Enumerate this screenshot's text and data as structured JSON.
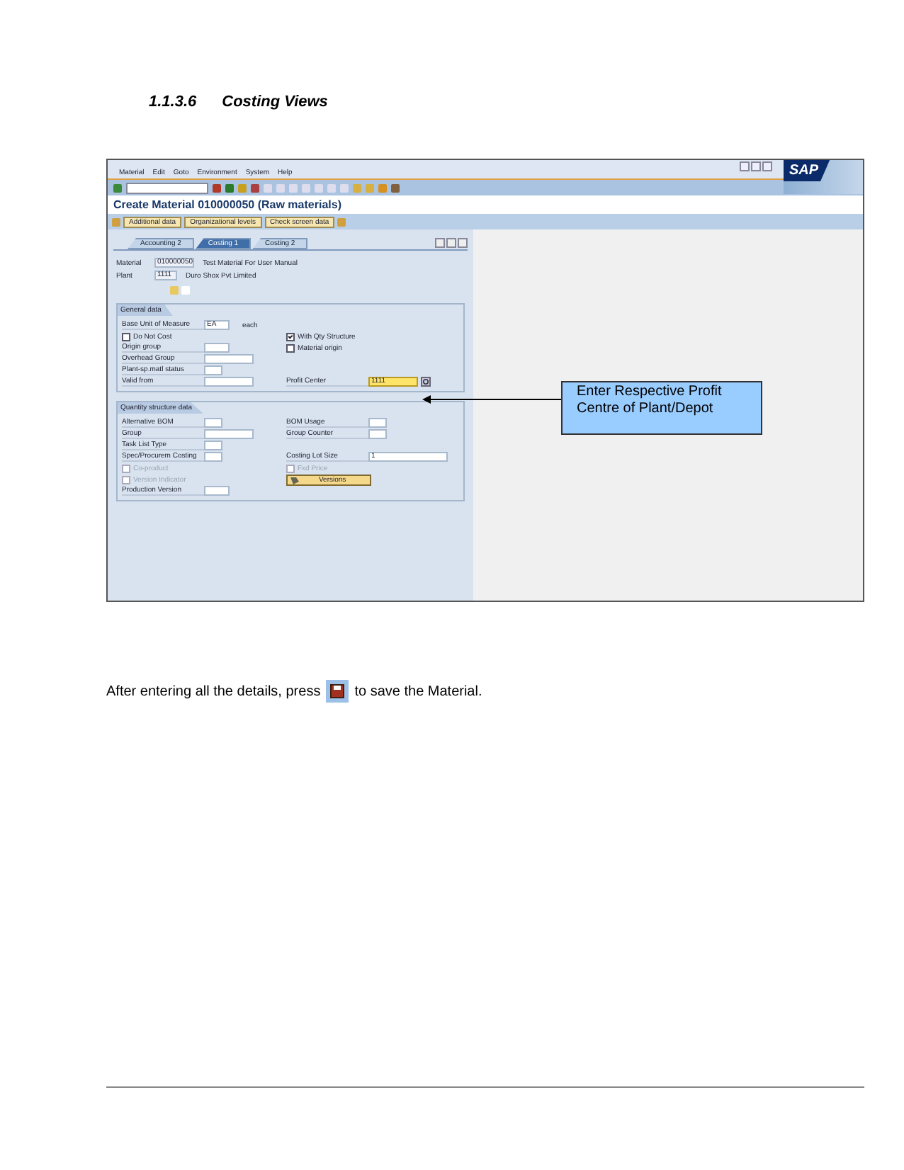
{
  "heading": {
    "number": "1.1.3.6",
    "title": "Costing Views"
  },
  "screen": {
    "menu": [
      "Material",
      "Edit",
      "Goto",
      "Environment",
      "System",
      "Help"
    ],
    "logo": "SAP",
    "title": "Create Material 010000050 (Raw materials)",
    "app_toolbar": [
      "Additional data",
      "Organizational levels",
      "Check screen data"
    ],
    "tabs": [
      {
        "label": "Accounting 2",
        "selected": false
      },
      {
        "label": "Costing 1",
        "selected": true
      },
      {
        "label": "Costing 2",
        "selected": false
      }
    ],
    "header": [
      {
        "label": "Material",
        "value": "010000050",
        "description": "Test Material For User Manual"
      },
      {
        "label": "Plant",
        "value": "1111",
        "description": "Duro Shox Pvt Limited"
      }
    ],
    "groups": [
      {
        "title": "General data",
        "rows": [
          [
            {
              "kind": "field",
              "label": "Base Unit of Measure",
              "value": "EA",
              "suffix": "each"
            }
          ],
          [
            {
              "kind": "checkbox",
              "label": "Do Not Cost",
              "checked": false,
              "disabled": false
            },
            {
              "kind": "checkbox",
              "label": "With Qty Structure",
              "checked": true,
              "disabled": false
            }
          ],
          [
            {
              "kind": "field",
              "label": "Origin group"
            },
            {
              "kind": "checkbox",
              "label": "Material origin",
              "checked": false,
              "disabled": false
            }
          ],
          [
            {
              "kind": "field",
              "label": "Overhead Group"
            }
          ],
          [
            {
              "kind": "field",
              "label": "Plant-sp.matl status"
            }
          ],
          [
            {
              "kind": "field",
              "label": "Valid from"
            },
            {
              "kind": "field",
              "label": "Profit Center",
              "value": "1111",
              "focused": true
            }
          ]
        ]
      },
      {
        "title": "Quantity structure data",
        "rows": [
          [
            {
              "kind": "field",
              "label": "Alternative BOM"
            },
            {
              "kind": "field",
              "label": "BOM Usage"
            }
          ],
          [
            {
              "kind": "field",
              "label": "Group"
            },
            {
              "kind": "field",
              "label": "Group Counter"
            }
          ],
          [
            {
              "kind": "field",
              "label": "Task List Type"
            }
          ],
          [
            {
              "kind": "field",
              "label": "Spec/Procurem Costing"
            },
            {
              "kind": "field",
              "label": "Costing Lot Size",
              "value": "1"
            }
          ],
          [
            {
              "kind": "checkbox",
              "label": "Co-product",
              "checked": false,
              "disabled": true
            },
            {
              "kind": "checkbox",
              "label": "Fxd Price",
              "checked": false,
              "disabled": true
            }
          ],
          [
            {
              "kind": "checkbox",
              "label": "Version Indicator",
              "checked": false,
              "disabled": true
            },
            {
              "kind": "button",
              "label": "Versions"
            }
          ],
          [
            {
              "kind": "field",
              "label": "Production Version"
            }
          ]
        ]
      }
    ],
    "callout": "Enter Respective Profit Centre of Plant/Depot"
  },
  "instruction": {
    "before": "After entering all the details, press",
    "after": "to save the Material."
  }
}
